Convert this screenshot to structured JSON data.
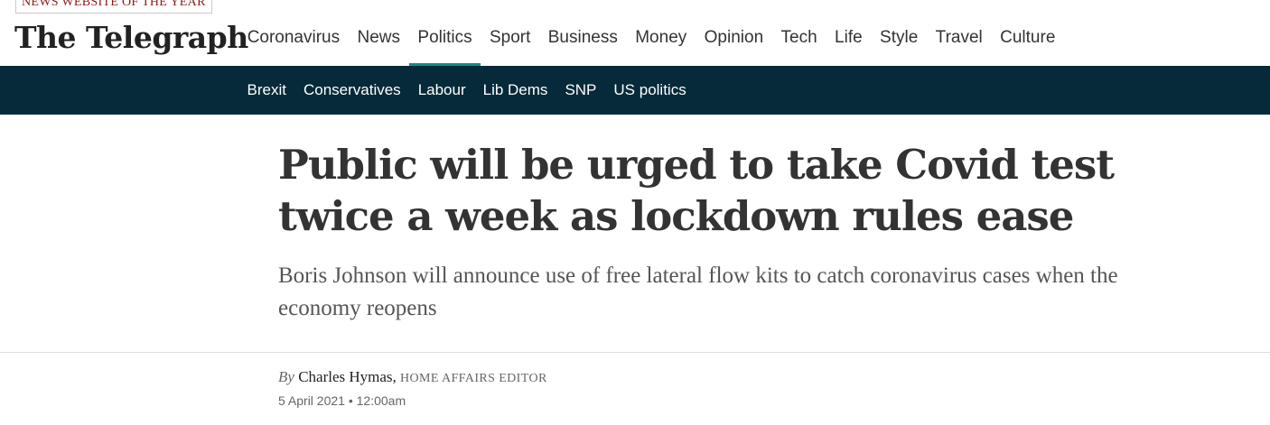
{
  "header": {
    "award_badge": "NEWS WEBSITE OF THE YEAR",
    "logo_text": "The Telegraph"
  },
  "primary_nav": {
    "items": [
      {
        "label": "Coronavirus"
      },
      {
        "label": "News"
      },
      {
        "label": "Politics",
        "active": true
      },
      {
        "label": "Sport"
      },
      {
        "label": "Business"
      },
      {
        "label": "Money"
      },
      {
        "label": "Opinion"
      },
      {
        "label": "Tech"
      },
      {
        "label": "Life"
      },
      {
        "label": "Style"
      },
      {
        "label": "Travel"
      },
      {
        "label": "Culture"
      }
    ]
  },
  "sub_nav": {
    "items": [
      {
        "label": "Brexit"
      },
      {
        "label": "Conservatives"
      },
      {
        "label": "Labour"
      },
      {
        "label": "Lib Dems"
      },
      {
        "label": "SNP"
      },
      {
        "label": "US politics"
      }
    ]
  },
  "article": {
    "headline": "Public will be urged to take Covid test twice a week as lockdown rules ease",
    "standfirst": "Boris Johnson will announce use of free lateral flow kits to catch coronavirus cases when the economy reopens",
    "byline": {
      "prefix": "By",
      "author": "Charles Hymas,",
      "role": "HOME AFFAIRS EDITOR"
    },
    "date": "5 April 2021 • 12:00am"
  },
  "colors": {
    "sub_nav_bg": "#062a3a",
    "active_underline": "#0c8f8f",
    "award_text": "#8a1c1c"
  }
}
